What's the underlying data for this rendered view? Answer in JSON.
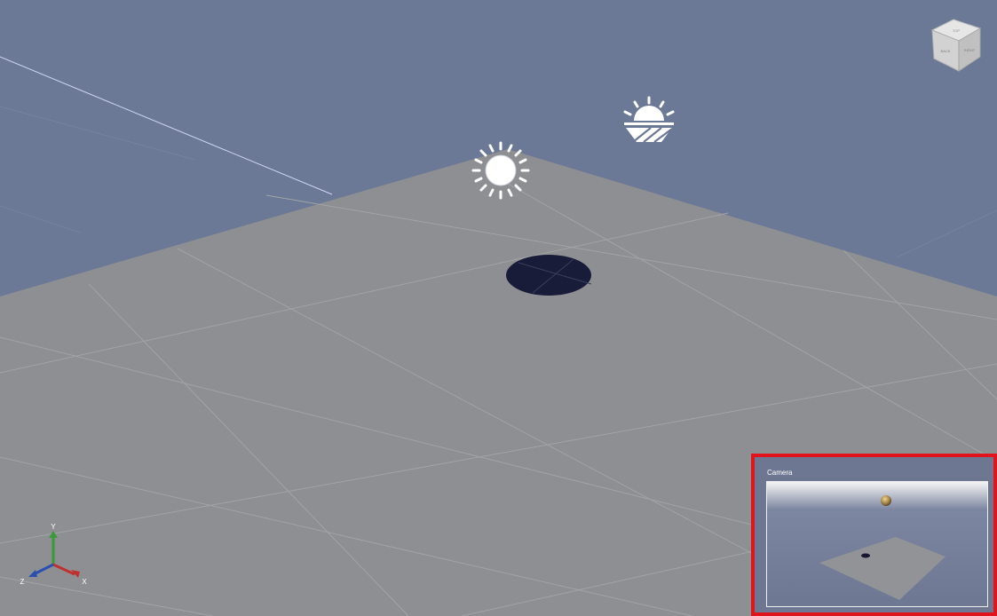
{
  "viewport": {
    "background_color": "#6b7896",
    "ground_color": "#8e8f92",
    "grid_line_color": "#a2a3a6",
    "hole_color": "#181c38"
  },
  "nav_cube": {
    "icon": "view-cube-icon",
    "top_label": "TOP",
    "left_label": "BACK",
    "right_label": "RIGHT"
  },
  "lights": {
    "point_light_icon": "sun-icon",
    "sky_light_icon": "sunrise-icon"
  },
  "axis_gizmo": {
    "x_label": "X",
    "y_label": "Y",
    "z_label": "Z",
    "x_color": "#c03030",
    "y_color": "#3a9a3a",
    "z_color": "#2a4fb0"
  },
  "camera_preview": {
    "title": "Camera",
    "border_color": "#e1141c",
    "sky_top": "#f4f4f4",
    "sky_bottom": "#6d7792",
    "plane_color": "#929396",
    "ball_color": "#a2834a"
  }
}
